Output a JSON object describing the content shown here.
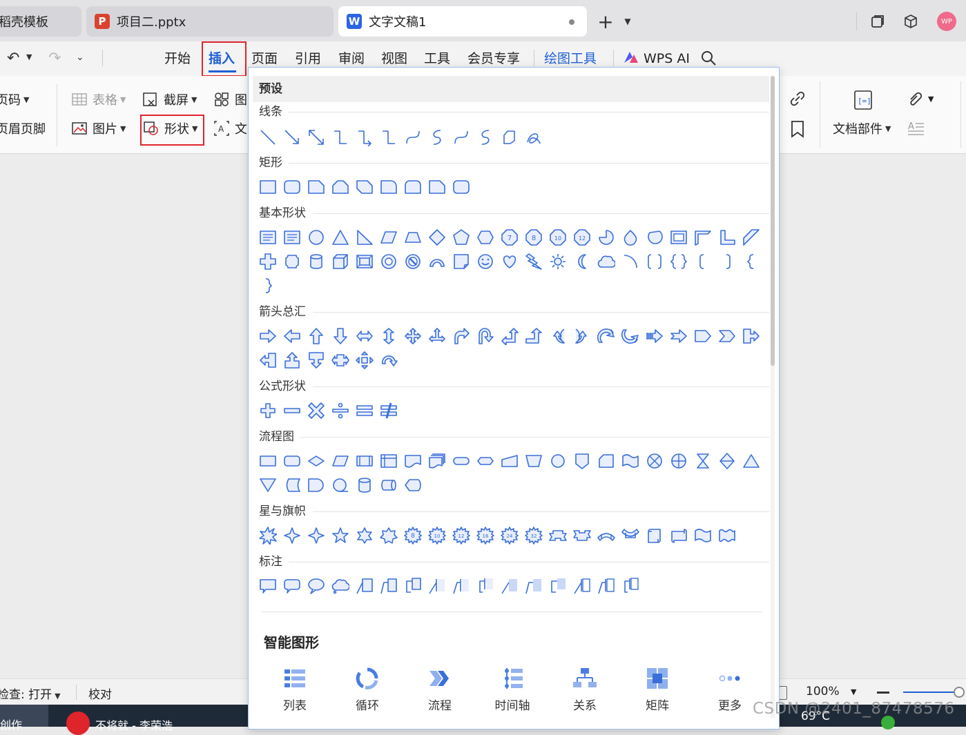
{
  "tabs": {
    "tab1": "稻壳模板",
    "tab2": "项目二.pptx",
    "tab3": "文字文稿1",
    "tab2_icon": "P",
    "tab3_icon": "W",
    "new_tab": "+",
    "avatar": "WP"
  },
  "menu": {
    "items": [
      "开始",
      "插入",
      "页面",
      "引用",
      "审阅",
      "视图",
      "工具",
      "会员专享",
      "绘图工具",
      "WPS AI"
    ],
    "active": "插入"
  },
  "ribbon": {
    "page_number": "页码",
    "header_footer": "页眉页脚",
    "table": "表格",
    "picture": "图片",
    "screenshot": "截屏",
    "shapes": "形状",
    "icon_partial": "图",
    "textbox_partial": "文",
    "doc_parts": "文档部件"
  },
  "panel": {
    "preset": "预设",
    "sections": {
      "lines": "线条",
      "rect": "矩形",
      "basic": "基本形状",
      "arrows": "箭头总汇",
      "formula": "公式形状",
      "flow": "流程图",
      "stars": "星与旗帜",
      "callout": "标注"
    },
    "smart_title": "智能图形",
    "smart_items": [
      "列表",
      "循环",
      "流程",
      "时间轴",
      "关系",
      "矩阵",
      "更多"
    ]
  },
  "status": {
    "spell": "检查: 打开",
    "proofread": "校对",
    "zoom": "100%"
  },
  "taskbar": {
    "left": "创作",
    "music": "不将就 - 李荣浩",
    "temp": "69°C"
  },
  "watermark": "CSDN @2401_87478576",
  "colors": {
    "accent": "#1f5fd6",
    "highlight_box": "#e0242c",
    "shape_stroke": "#3a6fd8",
    "shape_fill": "#e8eefc"
  }
}
